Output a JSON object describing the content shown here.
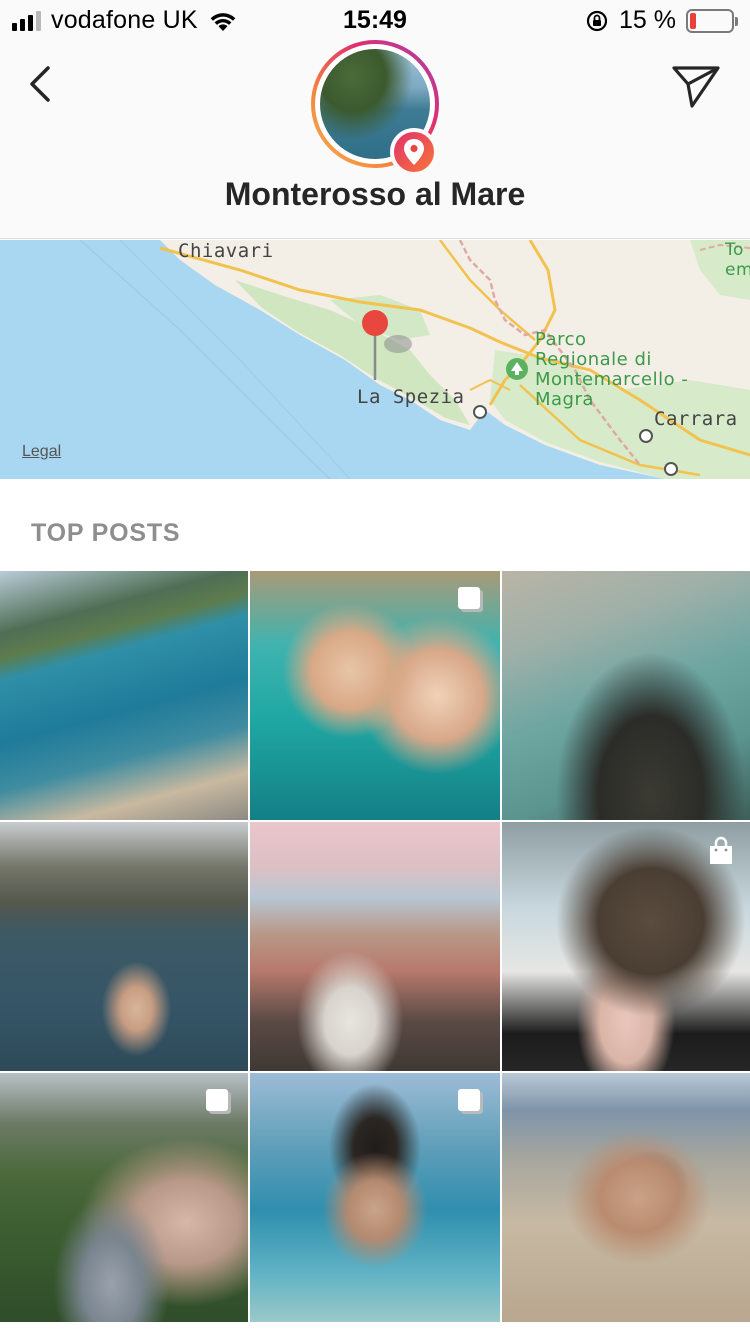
{
  "status_bar": {
    "carrier": "vodafone UK",
    "time": "15:49",
    "battery_percent": "15 %",
    "battery_level": 0.15,
    "battery_color": "#e8413d"
  },
  "header": {
    "back_icon": "chevron-left-icon",
    "send_icon": "paper-plane-icon",
    "avatar_badge_icon": "location-pin-icon",
    "place_name": "Monterosso al Mare"
  },
  "map": {
    "labels": {
      "chiavari": "Chiavari",
      "la_spezia": "La Spezia",
      "park": [
        "Parco",
        "Regionale di",
        "Montemarcello -",
        "Magra"
      ],
      "carrara": "Carrara",
      "corner": [
        "To",
        "em"
      ]
    },
    "legal_link": "Legal"
  },
  "section": {
    "title": "TOP POSTS"
  },
  "posts": [
    {
      "badge": ""
    },
    {
      "badge": "multiple-photos-icon"
    },
    {
      "badge": ""
    },
    {
      "badge": ""
    },
    {
      "badge": ""
    },
    {
      "badge": "shopping-bag-icon"
    },
    {
      "badge": "multiple-photos-icon"
    },
    {
      "badge": "multiple-photos-icon"
    },
    {
      "badge": ""
    }
  ]
}
